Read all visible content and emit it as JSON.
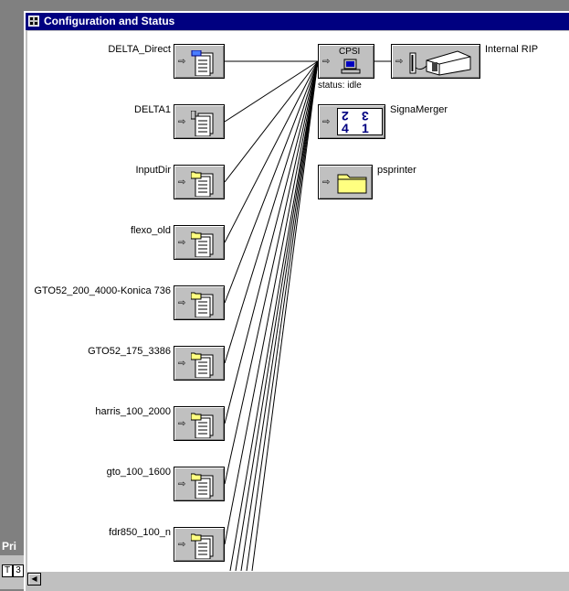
{
  "window": {
    "title": "Configuration and Status"
  },
  "inputs": [
    {
      "id": "delta_direct",
      "label": "DELTA_Direct"
    },
    {
      "id": "delta1",
      "label": "DELTA1"
    },
    {
      "id": "inputdir",
      "label": "InputDir"
    },
    {
      "id": "flexo_old",
      "label": "flexo_old"
    },
    {
      "id": "gto52_200",
      "label": "GTO52_200_4000-Konica 736"
    },
    {
      "id": "gto52_175",
      "label": "GTO52_175_3386"
    },
    {
      "id": "harris",
      "label": "harris_100_2000"
    },
    {
      "id": "gto100",
      "label": "gto_100_1600"
    },
    {
      "id": "fdr850",
      "label": "fdr850_100_n"
    }
  ],
  "cpsi": {
    "title": "CPSI",
    "status": "status: idle"
  },
  "internal_rip": {
    "label": "Internal RIP"
  },
  "signamerger": {
    "label": "SignaMerger",
    "digits": [
      "2",
      "3",
      "4",
      "1"
    ]
  },
  "psprinter": {
    "label": "psprinter"
  },
  "background_window": {
    "tab": "Pri",
    "cells": [
      "T",
      "3"
    ]
  },
  "colors": {
    "titlebar": "#000080",
    "chrome": "#c0c0c0",
    "canvas": "#ffffff",
    "desktop": "#808080"
  }
}
